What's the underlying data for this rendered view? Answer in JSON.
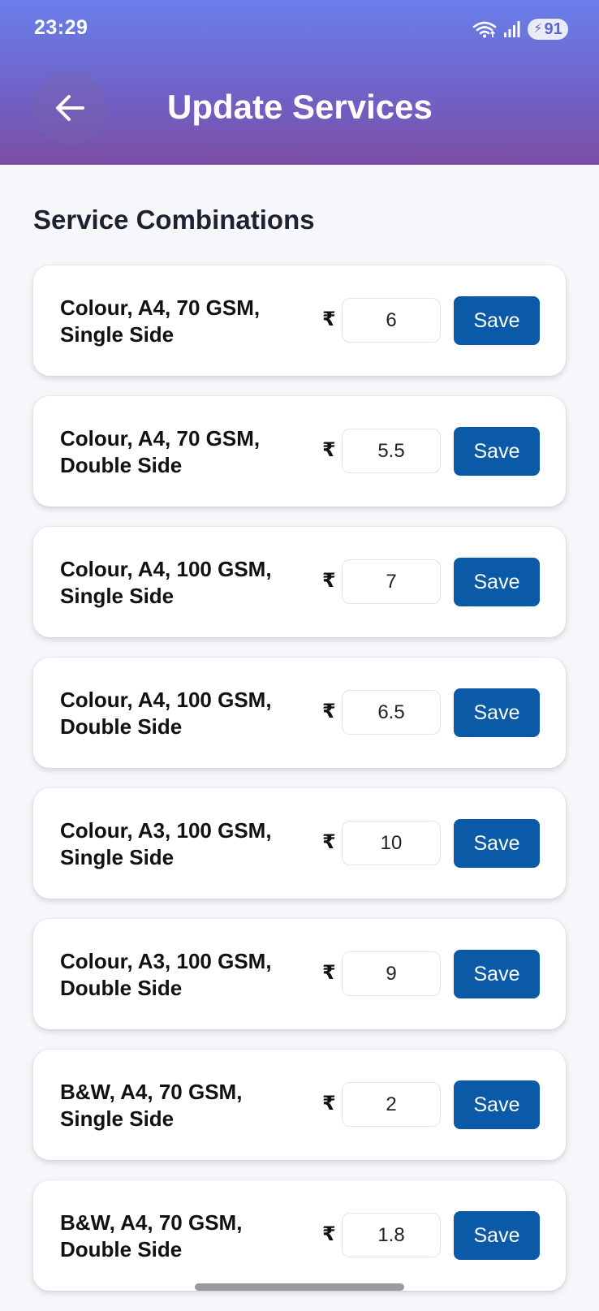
{
  "status_bar": {
    "time": "23:29",
    "battery": "91",
    "icons": [
      "wifi-icon",
      "signal-icon",
      "battery-charging-icon"
    ]
  },
  "header": {
    "title": "Update Services",
    "back_icon": "arrow-left-icon"
  },
  "section_title": "Service Combinations",
  "currency_symbol": "₹",
  "save_label": "Save",
  "services": [
    {
      "label": "Colour, A4, 70 GSM,\nSingle Side",
      "price": "6"
    },
    {
      "label": "Colour, A4, 70 GSM,\nDouble Side",
      "price": "5.5"
    },
    {
      "label": "Colour, A4, 100 GSM,\nSingle Side",
      "price": "7"
    },
    {
      "label": "Colour, A4, 100 GSM,\nDouble Side",
      "price": "6.5"
    },
    {
      "label": "Colour, A3, 100 GSM,\nSingle Side",
      "price": "10"
    },
    {
      "label": "Colour, A3, 100 GSM,\nDouble Side",
      "price": "9"
    },
    {
      "label": "B&W, A4, 70 GSM,\nSingle Side",
      "price": "2"
    },
    {
      "label": "B&W, A4, 70 GSM,\nDouble Side",
      "price": "1.8"
    }
  ],
  "colors": {
    "header_gradient_top": "#6a7fea",
    "header_gradient_bottom": "#7c4ea6",
    "save_button": "#0a5aa8",
    "background": "#f6f7fa"
  }
}
